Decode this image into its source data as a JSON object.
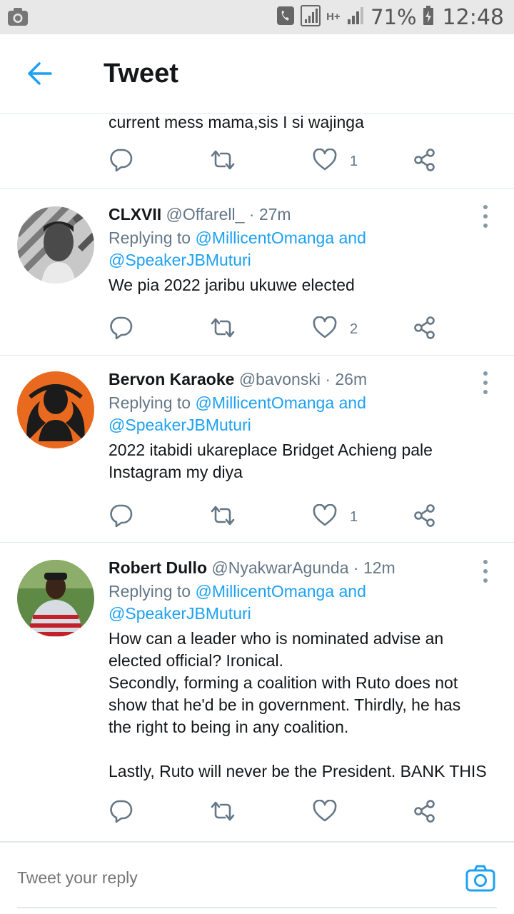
{
  "status_bar": {
    "battery": "71%",
    "time": "12:48",
    "network": "H+",
    "icons": [
      "camera-notification-icon",
      "phone-call-icon",
      "signal-icon",
      "signal-icon",
      "battery-charging-icon"
    ]
  },
  "header": {
    "title": "Tweet",
    "back_icon": "back-arrow-icon"
  },
  "partial_tweet": {
    "text": "current mess mama,sis I si wajinga",
    "like_count": "1"
  },
  "tweets": [
    {
      "name": "CLXVII",
      "handle": "@Offarell_",
      "time": "27m",
      "replying_prefix": "Replying to",
      "mention1": "@MillicentOmanga",
      "and": "and",
      "mention2": "@SpeakerJBMuturi",
      "text": "We pia 2022 jaribu ukuwe elected",
      "like_count": "2"
    },
    {
      "name": "Bervon Karaoke",
      "handle": "@bavonski",
      "time": "26m",
      "replying_prefix": "Replying to",
      "mention1": "@MillicentOmanga",
      "and": "and",
      "mention2": "@SpeakerJBMuturi",
      "text": "2022 itabidi ukareplace Bridget Achieng pale\nInstagram my diya",
      "like_count": "1"
    },
    {
      "name": "Robert Dullo",
      "handle": "@NyakwarAgunda",
      "time": "12m",
      "replying_prefix": "Replying to",
      "mention1": "@MillicentOmanga",
      "and": "and",
      "mention2": "@SpeakerJBMuturi",
      "text": "How can a leader who is nominated advise an\nelected official? Ironical.\nSecondly, forming a coalition with Ruto does not\nshow that he'd be in government. Thirdly, he has\nthe right to being in any coalition.\n\nLastly, Ruto will never be the President. BANK THIS",
      "like_count": ""
    }
  ],
  "reply_bar": {
    "placeholder": "Tweet your reply",
    "camera_icon": "camera-icon"
  },
  "colors": {
    "accent": "#1da1f2",
    "text": "#14171a",
    "secondary": "#657786",
    "divider": "#e1e8ed"
  }
}
